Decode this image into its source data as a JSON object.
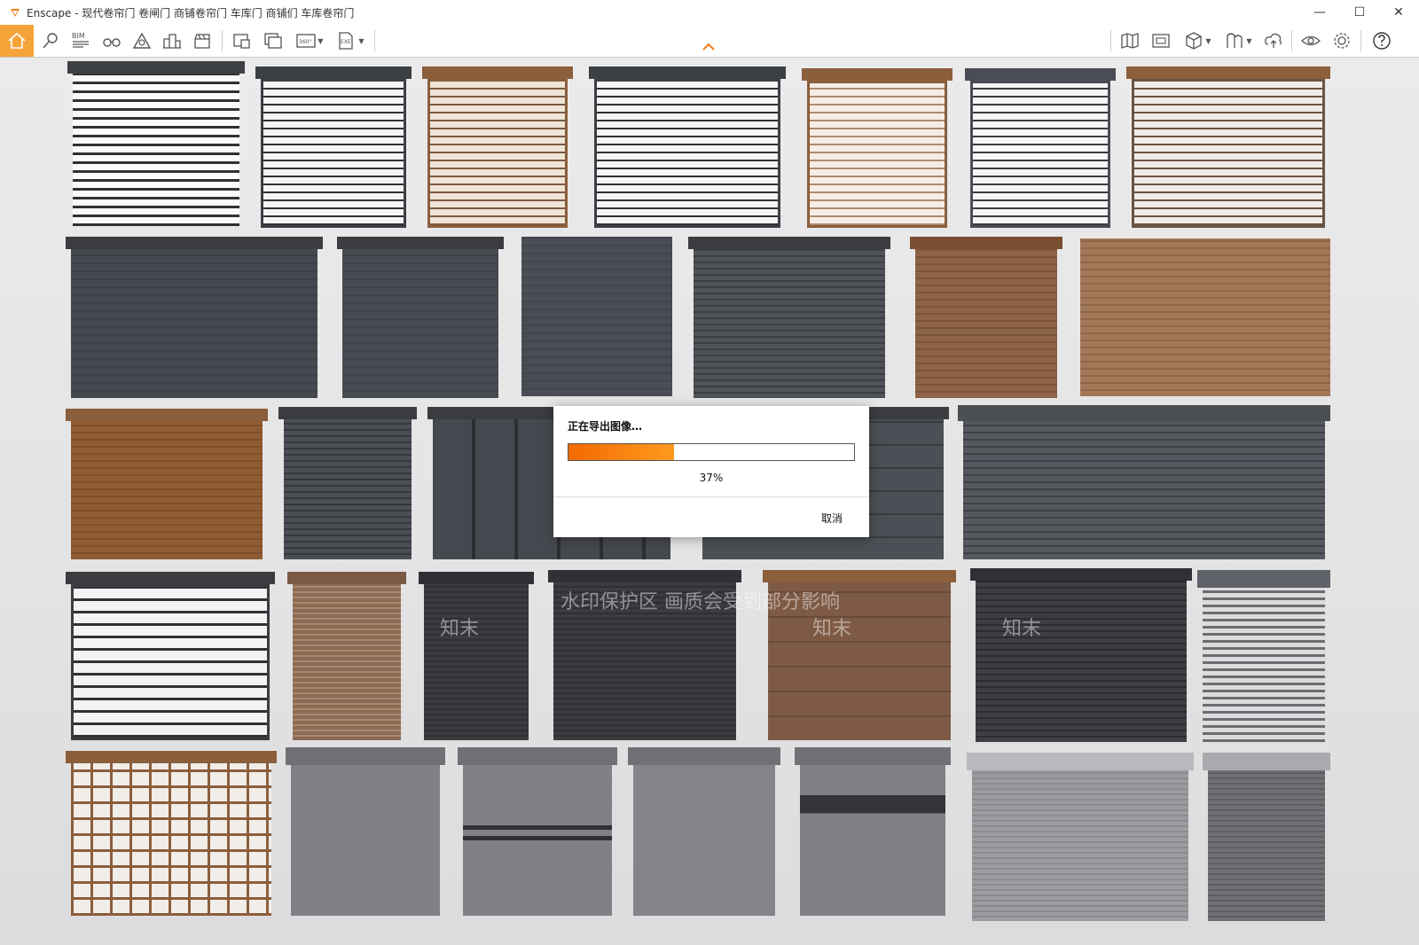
{
  "window": {
    "app_name": "Enscape",
    "title": "Enscape - 现代卷帘门 卷闸门 商铺卷帘门 车库门 商铺们 车库卷帘门",
    "minimize": "—",
    "maximize": "☐",
    "close": "✕"
  },
  "toolbar": {
    "bim_label": "BIM",
    "pano_label": "360°",
    "exe_label": "EXE"
  },
  "colors": {
    "accent": "#f5a43a",
    "progress": "#f26a00",
    "dark_door": "#4a4d53",
    "wood_door": "#8b5e3c",
    "grey_door": "#7f8186"
  },
  "dialog": {
    "title": "正在导出图像…",
    "progress_percent": 37,
    "progress_label": "37%",
    "cancel_label": "取消"
  },
  "watermark": {
    "banner": "水印保护区 画质会受到部分影响",
    "tag": "知末"
  }
}
